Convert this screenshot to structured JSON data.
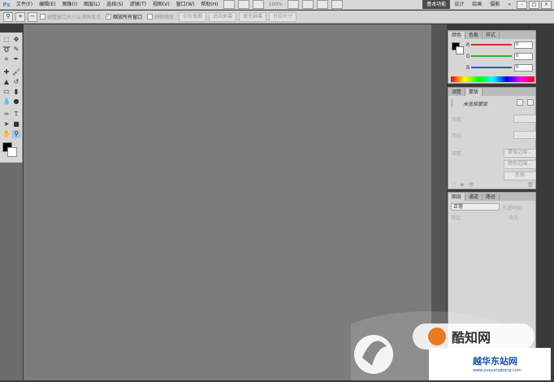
{
  "menubar": {
    "logo": "Ps",
    "items": [
      "文件(F)",
      "编辑(E)",
      "图像(I)",
      "图层(L)",
      "选择(S)",
      "滤镜(T)",
      "视图(V)",
      "窗口(W)",
      "帮助(H)"
    ],
    "zoom": "100%",
    "workspaces": {
      "active": "基本功能",
      "others": [
        "设计",
        "绘画",
        "摄影"
      ],
      "more": "»"
    },
    "window_controls": [
      "–",
      "□",
      "×"
    ]
  },
  "optbar": {
    "checks": [
      {
        "label": "调整窗口大小以满屏显示",
        "checked": false
      },
      {
        "label": "缩放所有窗口",
        "checked": true
      },
      {
        "label": "细微缩放",
        "checked": false
      }
    ],
    "buttons": [
      "实际像素",
      "适合屏幕",
      "填充屏幕",
      "打印尺寸"
    ]
  },
  "color_panel": {
    "tabs": [
      "颜色",
      "色板",
      "样式"
    ],
    "sliders": [
      {
        "label": "R",
        "value": "0",
        "color": "#d03030"
      },
      {
        "label": "G",
        "value": "0",
        "color": "#30b030"
      },
      {
        "label": "B",
        "value": "0",
        "color": "#3050d0"
      }
    ]
  },
  "adj_panel": {
    "tabs": [
      "调整",
      "蒙版"
    ],
    "title": "未选择蒙版",
    "labels": [
      "浓度",
      "羽化",
      "调整"
    ],
    "buttons": [
      "蒙版边缘...",
      "颜色范围...",
      "反相"
    ]
  },
  "layers_panel": {
    "tabs": [
      "图层",
      "通道",
      "路径"
    ],
    "blend_mode": "正常",
    "opacity_label": "不透明度:",
    "lock_label": "锁定:",
    "fill_label": "填充:"
  },
  "watermark": {
    "brand": "酷知网",
    "site": "越华东站网",
    "url": "www.yueyangbang.com"
  }
}
